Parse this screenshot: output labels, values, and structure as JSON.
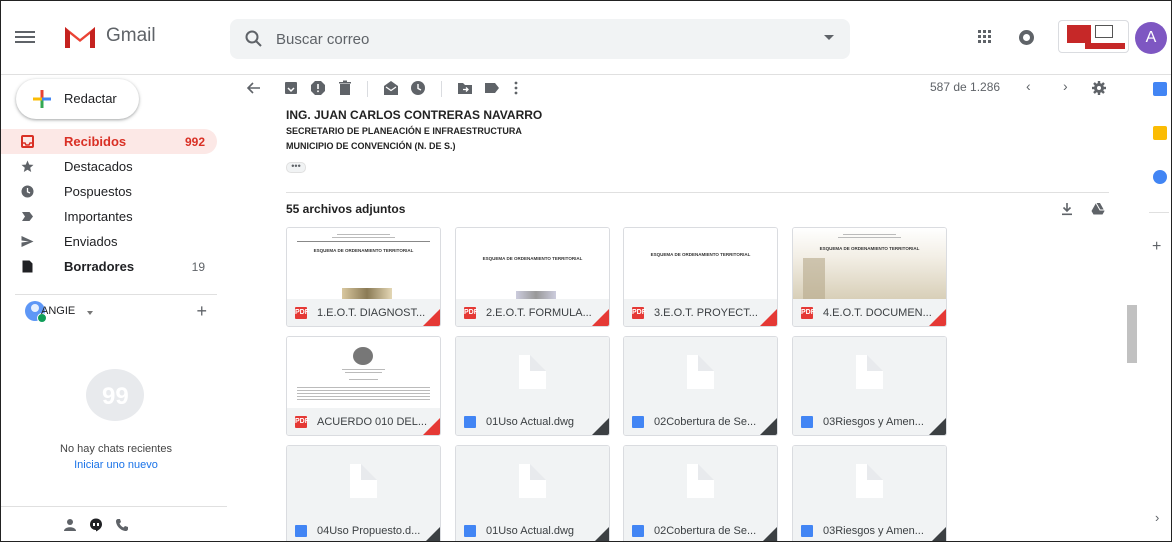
{
  "header": {
    "app_name": "Gmail",
    "search_placeholder": "Buscar correo",
    "avatar_letter": "A"
  },
  "sidebar": {
    "compose_label": "Redactar",
    "items": [
      {
        "label": "Recibidos",
        "count": "992",
        "icon": "inbox-icon",
        "active": true
      },
      {
        "label": "Destacados",
        "count": "",
        "icon": "star-icon"
      },
      {
        "label": "Pospuestos",
        "count": "",
        "icon": "clock-icon"
      },
      {
        "label": "Importantes",
        "count": "",
        "icon": "label-important-icon"
      },
      {
        "label": "Enviados",
        "count": "",
        "icon": "send-icon"
      },
      {
        "label": "Borradores",
        "count": "19",
        "icon": "draft-icon",
        "bold": true
      }
    ],
    "hangouts_user": "ANGIE",
    "no_chats": "No hay chats recientes",
    "start_chat": "Iniciar uno nuevo"
  },
  "toolbar": {
    "page_info": "587 de 1.286"
  },
  "email": {
    "signature_name": "ING. JUAN CARLOS CONTRERAS NAVARRO",
    "signature_role": "SECRETARIO DE PLANEACIÓN E INFRAESTRUCTURA",
    "signature_org": "MUNICIPIO DE CONVENCIÓN (N. DE S.)",
    "trimmed": "•••",
    "attachments_title": "55 archivos adjuntos",
    "attachments": [
      {
        "name": "1.E.O.T. DIAGNOST...",
        "type": "pdf",
        "thumb_title": "ESQUEMA DE ORDENAMIENTO TERRITORIAL"
      },
      {
        "name": "2.E.O.T. FORMULA...",
        "type": "pdf",
        "thumb_title": "ESQUEMA DE ORDENAMIENTO TERRITORIAL"
      },
      {
        "name": "3.E.O.T. PROYECT...",
        "type": "pdf",
        "thumb_title": "ESQUEMA DE ORDENAMIENTO TERRITORIAL"
      },
      {
        "name": "4.E.O.T. DOCUMEN...",
        "type": "pdf",
        "thumb_title": "ESQUEMA DE ORDENAMIENTO TERRITORIAL"
      },
      {
        "name": "ACUERDO 010 DEL...",
        "type": "pdf",
        "thumb_title": ""
      },
      {
        "name": "01Uso Actual.dwg",
        "type": "doc"
      },
      {
        "name": "02Cobertura de Se...",
        "type": "doc"
      },
      {
        "name": "03Riesgos y Amen...",
        "type": "doc"
      },
      {
        "name": "04Uso Propuesto.d...",
        "type": "doc"
      },
      {
        "name": "01Uso Actual.dwg",
        "type": "doc"
      },
      {
        "name": "02Cobertura de Se...",
        "type": "doc"
      },
      {
        "name": "03Riesgos y Amen...",
        "type": "doc"
      }
    ]
  },
  "colors": {
    "accent_red": "#d93025",
    "active_bg": "#fce8e6",
    "link_blue": "#1a73e8"
  }
}
